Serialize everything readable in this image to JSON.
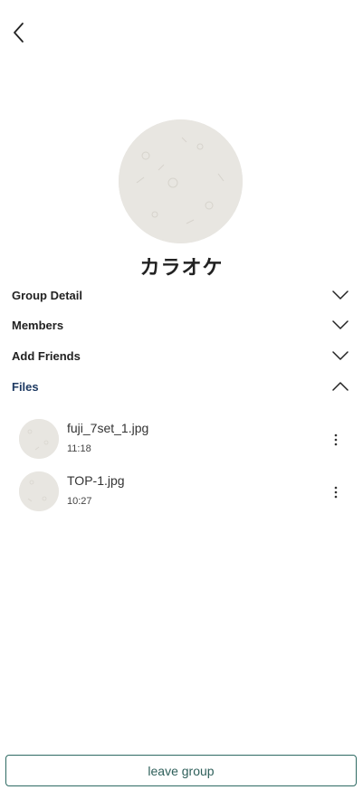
{
  "group": {
    "name": "カラオケ"
  },
  "sections": [
    {
      "label": "Group Detail",
      "expanded": false
    },
    {
      "label": "Members",
      "expanded": false
    },
    {
      "label": "Add Friends",
      "expanded": false
    },
    {
      "label": "Files",
      "expanded": true
    }
  ],
  "files": [
    {
      "name": "fuji_7set_1.jpg",
      "time": "11:18"
    },
    {
      "name": "TOP-1.jpg",
      "time": "10:27"
    }
  ],
  "actions": {
    "leave_label": "leave group"
  },
  "icons": {
    "back": "chevron-left-icon",
    "expand": "chevron-down-icon",
    "collapse": "chevron-up-icon",
    "more": "more-vertical-icon"
  },
  "colors": {
    "active_section": "#1f3b63",
    "leave_border": "#2e6a63",
    "avatar_bg": "#e8e6e1"
  }
}
